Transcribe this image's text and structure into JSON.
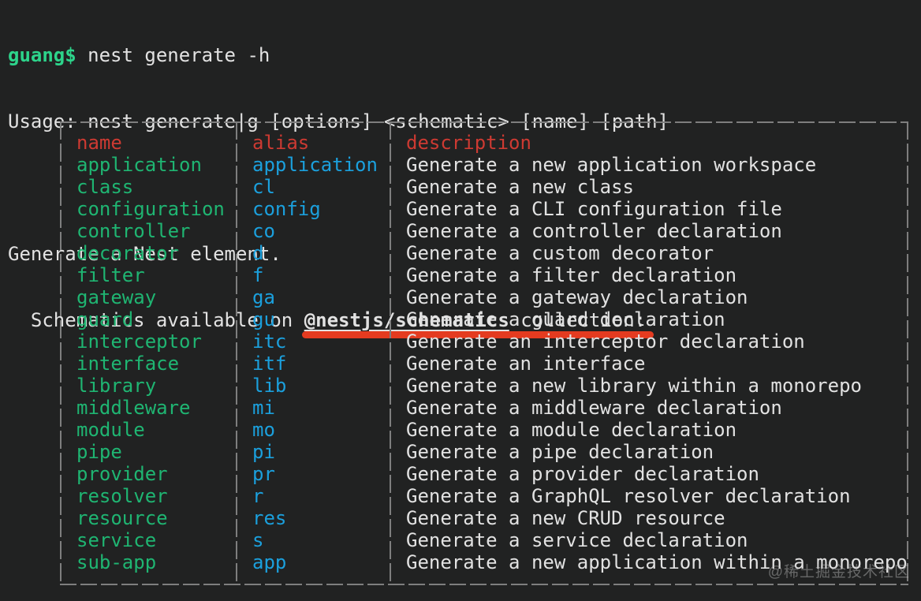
{
  "colors": {
    "bg": "#212222",
    "text": "#e2e2e2",
    "prompt-green": "#2dd48b",
    "name-green": "#1fb572",
    "alias-blue": "#1ba0dd",
    "header-red": "#cd3a32",
    "annotation-red": "#e43b20",
    "border-gray": "#7e7e7e"
  },
  "terminal": {
    "prompt": "guang$",
    "command": " nest generate -h",
    "usage": "Usage: nest generate|g [options] <schematic> [name] [path]",
    "intro": "Generate a Nest element.",
    "schematics_prefix": "  Schematics available on ",
    "schematics_package": "@nestjs/schematics",
    "schematics_suffix": " collection:"
  },
  "table": {
    "headers": {
      "name": "name",
      "alias": "alias",
      "description": "description"
    },
    "rows": [
      {
        "name": "application",
        "alias": "application",
        "description": "Generate a new application workspace"
      },
      {
        "name": "class",
        "alias": "cl",
        "description": "Generate a new class"
      },
      {
        "name": "configuration",
        "alias": "config",
        "description": "Generate a CLI configuration file"
      },
      {
        "name": "controller",
        "alias": "co",
        "description": "Generate a controller declaration"
      },
      {
        "name": "decorator",
        "alias": "d",
        "description": "Generate a custom decorator"
      },
      {
        "name": "filter",
        "alias": "f",
        "description": "Generate a filter declaration"
      },
      {
        "name": "gateway",
        "alias": "ga",
        "description": "Generate a gateway declaration"
      },
      {
        "name": "guard",
        "alias": "gu",
        "description": "Generate a guard declaration"
      },
      {
        "name": "interceptor",
        "alias": "itc",
        "description": "Generate an interceptor declaration"
      },
      {
        "name": "interface",
        "alias": "itf",
        "description": "Generate an interface"
      },
      {
        "name": "library",
        "alias": "lib",
        "description": "Generate a new library within a monorepo"
      },
      {
        "name": "middleware",
        "alias": "mi",
        "description": "Generate a middleware declaration"
      },
      {
        "name": "module",
        "alias": "mo",
        "description": "Generate a module declaration"
      },
      {
        "name": "pipe",
        "alias": "pi",
        "description": "Generate a pipe declaration"
      },
      {
        "name": "provider",
        "alias": "pr",
        "description": "Generate a provider declaration"
      },
      {
        "name": "resolver",
        "alias": "r",
        "description": "Generate a GraphQL resolver declaration"
      },
      {
        "name": "resource",
        "alias": "res",
        "description": "Generate a new CRUD resource"
      },
      {
        "name": "service",
        "alias": "s",
        "description": "Generate a service declaration"
      },
      {
        "name": "sub-app",
        "alias": "app",
        "description": "Generate a new application within a monorepo"
      }
    ]
  },
  "watermark": "@稀土掘金技术社区"
}
